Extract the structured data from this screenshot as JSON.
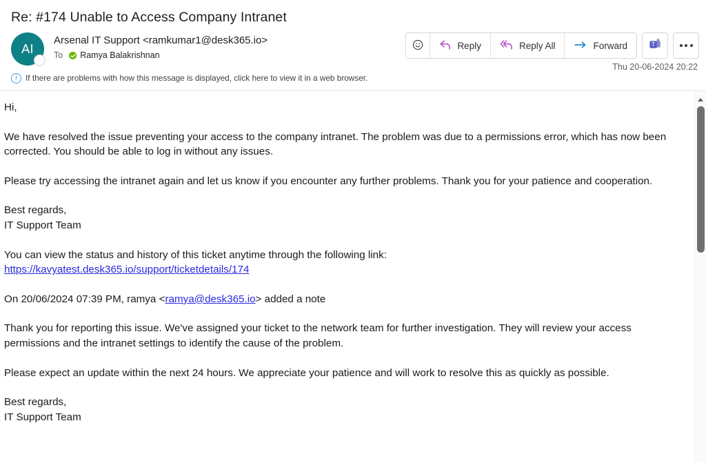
{
  "email": {
    "subject": "Re: #174 Unable to Access Company Intranet",
    "avatar_initials": "AI",
    "avatar_color": "#0e8186",
    "sender": "Arsenal IT Support <ramkumar1@desk365.io>",
    "to_label": "To",
    "recipient": "Ramya Balakrishnan",
    "recipient_presence": "available",
    "timestamp": "Thu 20-06-2024 20:22",
    "info_bar": {
      "icon": "info-icon",
      "text": "If there are problems with how this message is displayed, click here to view it in a web browser."
    }
  },
  "toolbar": {
    "emoji_label": "☺",
    "reply_label": "Reply",
    "reply_all_label": "Reply All",
    "forward_label": "Forward",
    "teams_label": "Share to Teams",
    "more_label": "More actions",
    "reply_arrow_color": "#b146c2",
    "forward_arrow_color": "#0078d4",
    "teams_color": "#6264a7"
  },
  "body": {
    "greeting": "Hi,",
    "para1": "We have resolved the issue preventing your access to the company intranet. The problem was due to a permissions error, which has now been corrected. You should be able to log in without any issues.",
    "para2": "Please try accessing the intranet again and let us know if you encounter any further problems. Thank you for your patience and cooperation.",
    "signoff1": "Best regards,",
    "signoff1_name": "IT Support Team",
    "link_intro": "You can view the status and history of this ticket anytime through the following link:",
    "ticket_link": "https://kavyatest.desk365.io/support/ticketdetails/174",
    "note_prefix": "On 20/06/2024 07:39 PM, ramya <",
    "note_email": "ramya@desk365.io",
    "note_suffix": "> added a note",
    "para3": "Thank you for reporting this issue. We've assigned your ticket to the network team for further investigation. They will review your access permissions and the intranet settings to identify the cause of the problem.",
    "para4": "Please expect an update within the next 24 hours. We appreciate your patience and will work to resolve this as quickly as possible.",
    "signoff2": "Best regards,",
    "signoff2_name": "IT Support Team"
  },
  "scrollbar": {
    "up_arrow": "scroll-up-arrow",
    "thumb": "scroll-thumb"
  }
}
